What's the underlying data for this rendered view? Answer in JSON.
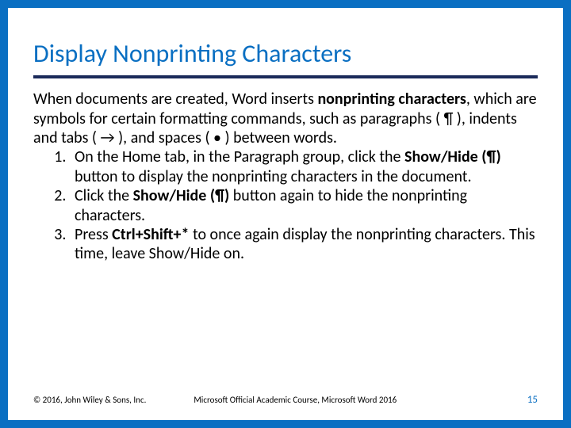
{
  "title": "Display Nonprinting Characters",
  "intro": {
    "part1": "When documents are created, Word inserts ",
    "bold1": "nonprinting characters",
    "part2": ", which are symbols for certain formatting commands, such as paragraphs ( ¶ ), indents and tabs ( → ), and spaces ( • ) between words."
  },
  "steps": [
    {
      "seg1": "On the Home tab, in the Paragraph group, click the ",
      "bold1": "Show/Hide (¶)",
      "seg2": " button to display the nonprinting characters in the document."
    },
    {
      "seg1": "Click the ",
      "bold1": "Show/Hide (¶)",
      "seg2": " button again to hide the nonprinting characters."
    },
    {
      "seg1": "Press ",
      "bold1": "Ctrl+Shift+*",
      "seg2": " to once again display the nonprinting characters. This time, leave Show/Hide on."
    }
  ],
  "footer": {
    "copyright": "© 2016, John Wiley & Sons, Inc.",
    "course": "Microsoft Official Academic Course, Microsoft Word 2016",
    "page": "15"
  }
}
